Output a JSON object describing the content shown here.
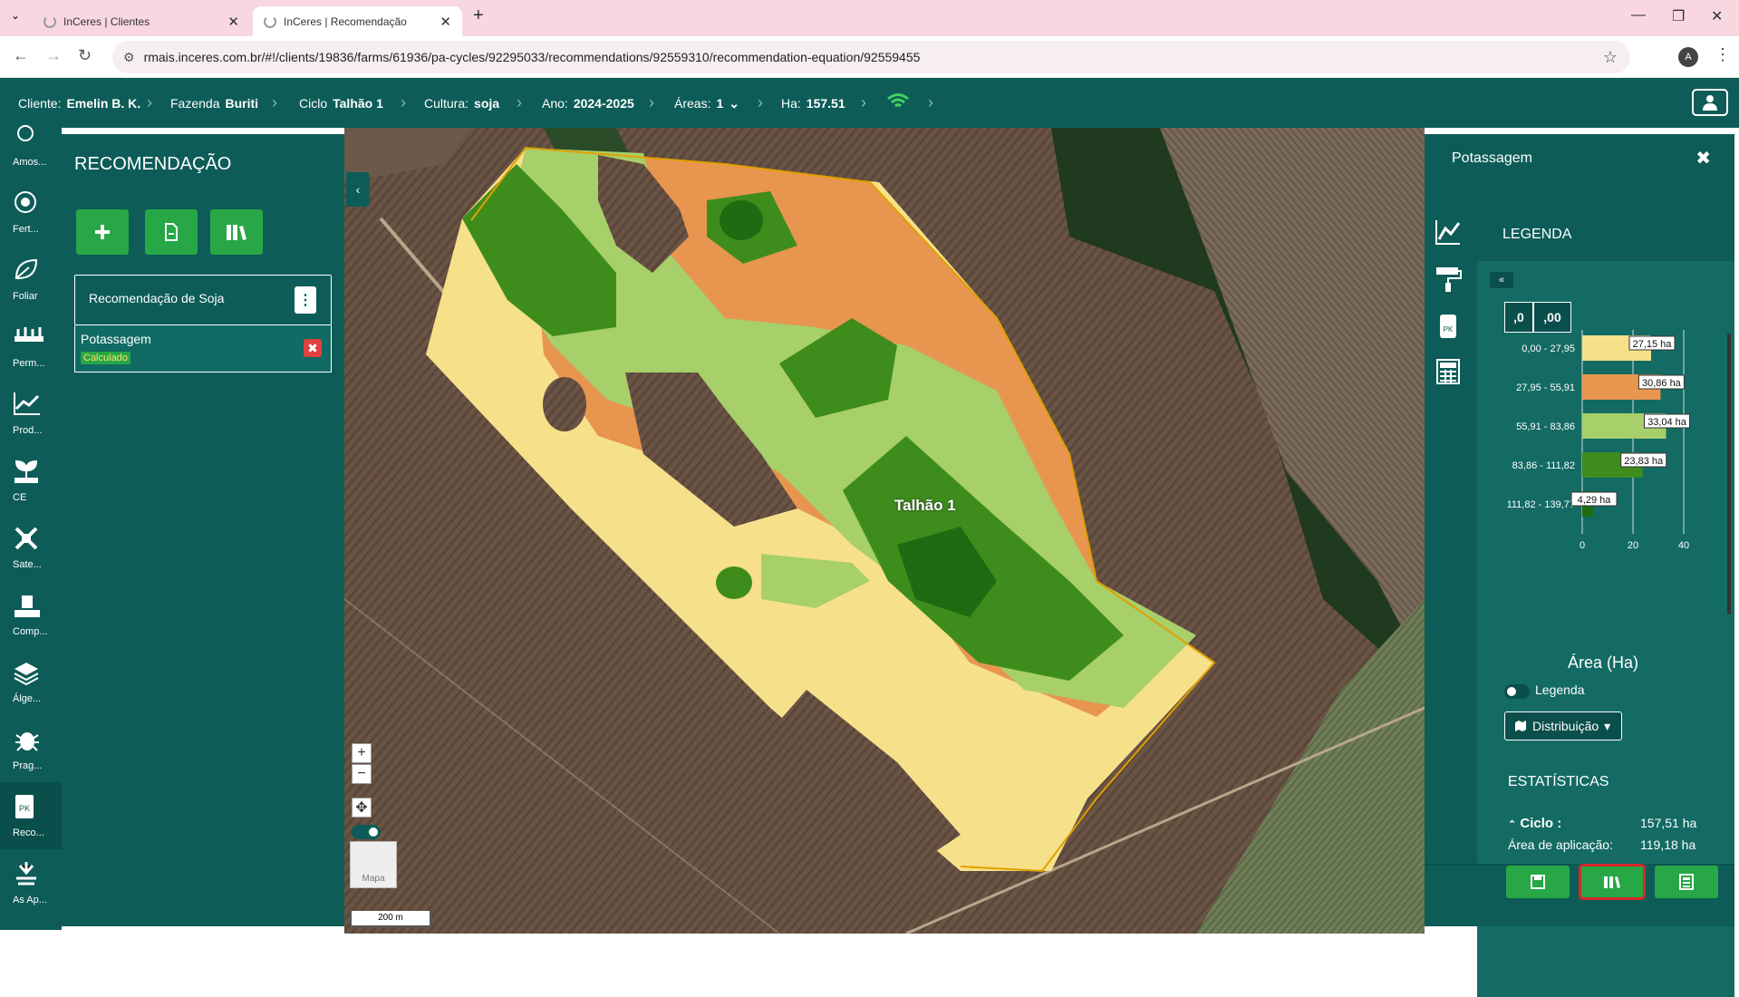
{
  "browser": {
    "tabs": [
      {
        "title": "InCeres | Clientes",
        "active": false
      },
      {
        "title": "InCeres | Recomendação",
        "active": true
      }
    ],
    "url": "rmais.inceres.com.br/#!/clients/19836/farms/61936/pa-cycles/92295033/recommendations/92559310/recommendation-equation/92559455",
    "profile_initial": "A"
  },
  "topbar": {
    "client_label": "Cliente:",
    "client_value": "Emelin B. K.",
    "farm_label": "Fazenda",
    "farm_value": "Buriti",
    "cycle_label": "Ciclo",
    "cycle_value": "Talhão 1",
    "crop_label": "Cultura:",
    "crop_value": "soja",
    "year_label": "Ano:",
    "year_value": "2024-2025",
    "areas_label": "Áreas:",
    "areas_value": "1",
    "ha_label": "Ha:",
    "ha_value": "157.51"
  },
  "left_nav": [
    {
      "label": "Amos...",
      "icon": "sampling-icon"
    },
    {
      "label": "Fert...",
      "icon": "fertility-icon"
    },
    {
      "label": "Foliar",
      "icon": "leaf-icon"
    },
    {
      "label": "Perm...",
      "icon": "tractor-icon"
    },
    {
      "label": "Prod...",
      "icon": "chart-line-icon"
    },
    {
      "label": "CE",
      "icon": "plant-icon"
    },
    {
      "label": "Sate...",
      "icon": "satellite-icon"
    },
    {
      "label": "Comp...",
      "icon": "compaction-icon"
    },
    {
      "label": "Álge...",
      "icon": "layers-icon"
    },
    {
      "label": "Prag...",
      "icon": "bug-icon"
    },
    {
      "label": "Reco...",
      "icon": "recommendation-icon",
      "active": true
    },
    {
      "label": "As Ap...",
      "icon": "sprayer-icon"
    }
  ],
  "side_panel": {
    "title": "RECOMENDAÇÃO",
    "recommendation_name": "Recomendação de Soja",
    "item_name": "Potassagem",
    "item_status": "Calculado"
  },
  "map": {
    "field_label": "Talhão 1",
    "thumb_label": "Mapa",
    "scale_label": "200 m"
  },
  "right_panel": {
    "title": "Potassagem",
    "legend_title": "LEGENDA",
    "decimals_minus": ",0",
    "decimals_plus": ",00",
    "area_label": "Área (Ha)",
    "legend_toggle_label": "Legenda",
    "distribution_label": "Distribuição",
    "stats_title": "ESTATÍSTICAS",
    "stats": [
      {
        "label": "Ciclo",
        "value": "157,51 ha"
      },
      {
        "label": "Área de aplicação:",
        "value": "119,18 ha"
      }
    ]
  },
  "chart_data": {
    "type": "bar",
    "orientation": "horizontal",
    "categories": [
      "0,00 - 27,95",
      "27,95 - 55,91",
      "55,91 - 83,86",
      "83,86 - 111,82",
      "111,82 - 139,77"
    ],
    "values": [
      27.15,
      30.86,
      33.04,
      23.83,
      4.29
    ],
    "value_labels": [
      "27,15 ha",
      "30,86 ha",
      "33,04 ha",
      "23,83 ha",
      "4,29 ha"
    ],
    "colors": [
      "#f7e08a",
      "#e8954f",
      "#a7cf6a",
      "#3e8d1c",
      "#1e6b12"
    ],
    "xlim": [
      0,
      40
    ],
    "xticks": [
      "0",
      "20",
      "40"
    ],
    "grid": true,
    "xlabel": "Área (Ha)"
  },
  "colors": {
    "primary": "#0d5c58",
    "accent": "#27a745"
  }
}
